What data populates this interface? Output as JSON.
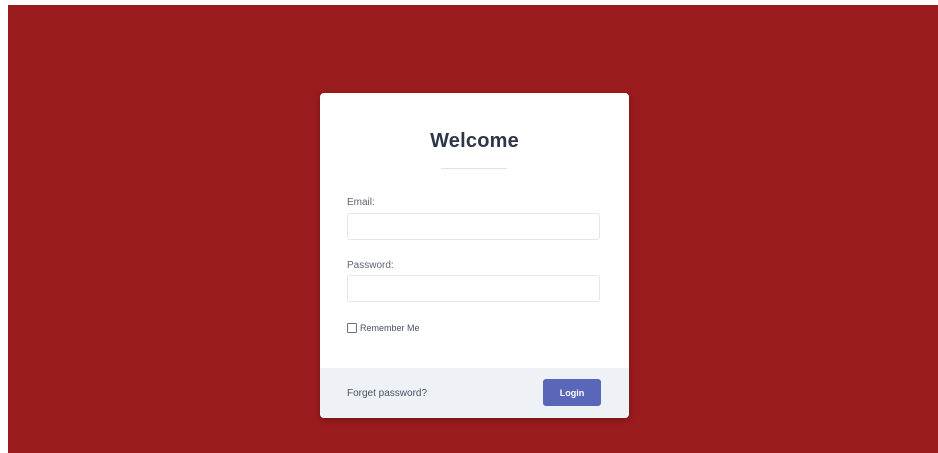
{
  "colors": {
    "background": "#9a1b1d",
    "card": "#ffffff",
    "footer": "#eef1f6",
    "title": "#2d3748",
    "accent": "#5a67b8"
  },
  "login_card": {
    "title": "Welcome",
    "email": {
      "label": "Email:",
      "value": "",
      "placeholder": ""
    },
    "password": {
      "label": "Password:",
      "value": "",
      "placeholder": ""
    },
    "remember": {
      "label": "Remember Me",
      "checked": false
    },
    "footer": {
      "forgot_link": "Forget password?",
      "login_button": "Login"
    }
  }
}
